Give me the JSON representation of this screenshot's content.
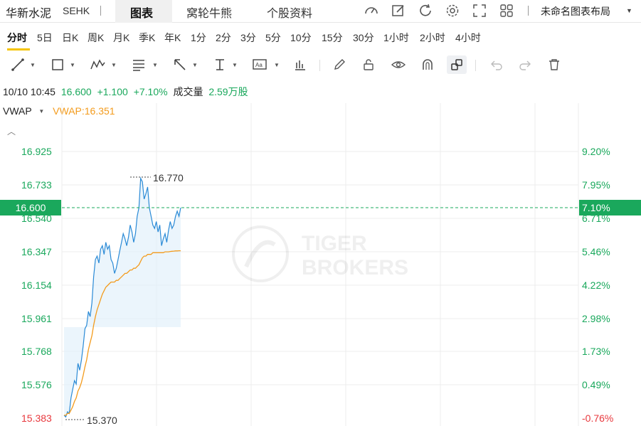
{
  "header": {
    "stock_name": "华新水泥",
    "exchange": "SEHK",
    "tabs": [
      {
        "label": "图表",
        "active": true
      },
      {
        "label": "窝轮牛熊",
        "active": false
      },
      {
        "label": "个股资料",
        "active": false
      }
    ],
    "toolbar_icons": [
      "gauge-icon",
      "edit-icon",
      "refresh-icon",
      "settings-icon",
      "fullscreen-icon",
      "grid-icon"
    ],
    "layout_label": "未命名图表布局"
  },
  "periods": {
    "items": [
      "分时",
      "5日",
      "日K",
      "周K",
      "月K",
      "季K",
      "年K",
      "1分",
      "2分",
      "3分",
      "5分",
      "10分",
      "15分",
      "30分",
      "1小时",
      "2小时",
      "4小时"
    ],
    "active": "分时"
  },
  "draw_tools": [
    "line-tool-icon",
    "rect-tool-icon",
    "wave-tool-icon",
    "fib-tool-icon",
    "arrow-tool-icon",
    "text-cursor-tool-icon",
    "annotation-tool-icon",
    "measure-tool-icon",
    "pencil-icon",
    "lock-icon",
    "eye-icon",
    "magnet-icon",
    "link-icon",
    "undo-icon",
    "redo-icon",
    "trash-icon"
  ],
  "quote": {
    "datetime": "10/10 10:45",
    "price": "16.600",
    "change": "+1.100",
    "change_pct": "+7.10%",
    "volume_label": "成交量",
    "volume": "2.59万股"
  },
  "indicator": {
    "name": "VWAP",
    "value_label": "VWAP:16.351"
  },
  "axis": {
    "price_ticks": [
      "16.925",
      "16.733",
      "16.540",
      "16.347",
      "16.154",
      "15.961",
      "15.768",
      "15.576",
      "15.383"
    ],
    "pct_ticks": [
      "9.20%",
      "7.95%",
      "6.71%",
      "5.46%",
      "4.22%",
      "2.98%",
      "1.73%",
      "0.49%",
      "-0.76%"
    ],
    "current_price": "16.600",
    "current_pct": "7.10%",
    "high_label": "16.770",
    "low_label": "15.370"
  },
  "watermark": {
    "line1": "TIGER",
    "line2": "BROKERS"
  },
  "colors": {
    "up": "#1aa85c",
    "down": "#e8383d",
    "price_line": "#2a8ad6",
    "vwap_line": "#f39b1c",
    "accent": "#f5c400"
  },
  "chart_data": {
    "type": "line",
    "ylim": [
      15.383,
      16.925
    ],
    "series": [
      {
        "name": "",
        "values": [
          15.4,
          15.39,
          15.42,
          15.41,
          15.5,
          15.55,
          15.6,
          15.58,
          15.7,
          15.66,
          15.72,
          15.8,
          15.9,
          15.92,
          16.0,
          15.97,
          16.05,
          16.2,
          16.3,
          16.32,
          16.28,
          16.36,
          16.38,
          16.33,
          16.4,
          16.36,
          16.38,
          16.3,
          16.28,
          16.22,
          16.25,
          16.3,
          16.35,
          16.4,
          16.45,
          16.42,
          16.38,
          16.43,
          16.5,
          16.46,
          16.4,
          16.45,
          16.55,
          16.6,
          16.77,
          16.75,
          16.65,
          16.68,
          16.72,
          16.6,
          16.55,
          16.5,
          16.48,
          16.52,
          16.46,
          16.5,
          16.38,
          16.42,
          16.45,
          16.4,
          16.47,
          16.52,
          16.48,
          16.5,
          16.55,
          16.58,
          16.55,
          16.6
        ]
      },
      {
        "name": "VWAP",
        "values": [
          15.4,
          15.4,
          15.41,
          15.41,
          15.43,
          15.45,
          15.48,
          15.5,
          15.54,
          15.56,
          15.59,
          15.63,
          15.68,
          15.72,
          15.78,
          15.82,
          15.86,
          15.92,
          15.97,
          16.01,
          16.04,
          16.07,
          16.1,
          16.12,
          16.14,
          16.15,
          16.16,
          16.17,
          16.17,
          16.17,
          16.18,
          16.18,
          16.19,
          16.2,
          16.21,
          16.22,
          16.22,
          16.23,
          16.24,
          16.24,
          16.25,
          16.25,
          16.26,
          16.27,
          16.29,
          16.31,
          16.32,
          16.32,
          16.33,
          16.33,
          16.33,
          16.34,
          16.34,
          16.34,
          16.34,
          16.34,
          16.34,
          16.34,
          16.345,
          16.345,
          16.345,
          16.347,
          16.348,
          16.349,
          16.35,
          16.35,
          16.351,
          16.351
        ]
      }
    ]
  }
}
